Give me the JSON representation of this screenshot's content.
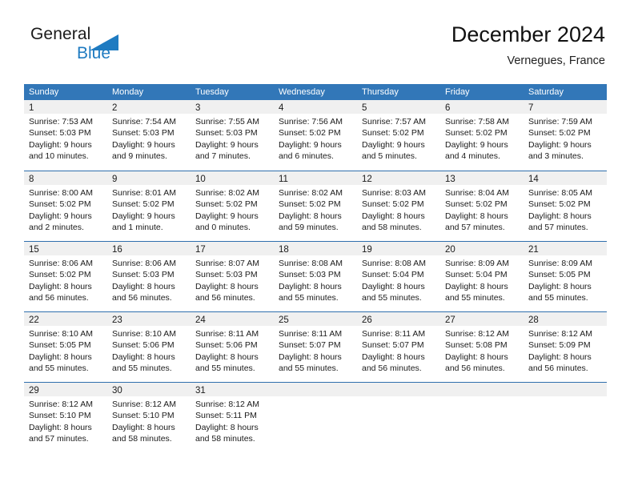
{
  "brand": {
    "line1": "General",
    "line2": "Blue",
    "mark_color": "#1f7bc1",
    "mark_icon": "triangle-logo-icon"
  },
  "header": {
    "title": "December 2024",
    "subtitle": "Vernegues, France"
  },
  "theme": {
    "header_blue": "#3277b8",
    "separator_blue": "#2f6fad",
    "day_band_gray": "#f0f0f0",
    "text_dark": "#1b1b1b"
  },
  "weekdays": [
    "Sunday",
    "Monday",
    "Tuesday",
    "Wednesday",
    "Thursday",
    "Friday",
    "Saturday"
  ],
  "weeks": [
    [
      {
        "day": "1",
        "sunrise": "Sunrise: 7:53 AM",
        "sunset": "Sunset: 5:03 PM",
        "daylight1": "Daylight: 9 hours",
        "daylight2": "and 10 minutes."
      },
      {
        "day": "2",
        "sunrise": "Sunrise: 7:54 AM",
        "sunset": "Sunset: 5:03 PM",
        "daylight1": "Daylight: 9 hours",
        "daylight2": "and 9 minutes."
      },
      {
        "day": "3",
        "sunrise": "Sunrise: 7:55 AM",
        "sunset": "Sunset: 5:03 PM",
        "daylight1": "Daylight: 9 hours",
        "daylight2": "and 7 minutes."
      },
      {
        "day": "4",
        "sunrise": "Sunrise: 7:56 AM",
        "sunset": "Sunset: 5:02 PM",
        "daylight1": "Daylight: 9 hours",
        "daylight2": "and 6 minutes."
      },
      {
        "day": "5",
        "sunrise": "Sunrise: 7:57 AM",
        "sunset": "Sunset: 5:02 PM",
        "daylight1": "Daylight: 9 hours",
        "daylight2": "and 5 minutes."
      },
      {
        "day": "6",
        "sunrise": "Sunrise: 7:58 AM",
        "sunset": "Sunset: 5:02 PM",
        "daylight1": "Daylight: 9 hours",
        "daylight2": "and 4 minutes."
      },
      {
        "day": "7",
        "sunrise": "Sunrise: 7:59 AM",
        "sunset": "Sunset: 5:02 PM",
        "daylight1": "Daylight: 9 hours",
        "daylight2": "and 3 minutes."
      }
    ],
    [
      {
        "day": "8",
        "sunrise": "Sunrise: 8:00 AM",
        "sunset": "Sunset: 5:02 PM",
        "daylight1": "Daylight: 9 hours",
        "daylight2": "and 2 minutes."
      },
      {
        "day": "9",
        "sunrise": "Sunrise: 8:01 AM",
        "sunset": "Sunset: 5:02 PM",
        "daylight1": "Daylight: 9 hours",
        "daylight2": "and 1 minute."
      },
      {
        "day": "10",
        "sunrise": "Sunrise: 8:02 AM",
        "sunset": "Sunset: 5:02 PM",
        "daylight1": "Daylight: 9 hours",
        "daylight2": "and 0 minutes."
      },
      {
        "day": "11",
        "sunrise": "Sunrise: 8:02 AM",
        "sunset": "Sunset: 5:02 PM",
        "daylight1": "Daylight: 8 hours",
        "daylight2": "and 59 minutes."
      },
      {
        "day": "12",
        "sunrise": "Sunrise: 8:03 AM",
        "sunset": "Sunset: 5:02 PM",
        "daylight1": "Daylight: 8 hours",
        "daylight2": "and 58 minutes."
      },
      {
        "day": "13",
        "sunrise": "Sunrise: 8:04 AM",
        "sunset": "Sunset: 5:02 PM",
        "daylight1": "Daylight: 8 hours",
        "daylight2": "and 57 minutes."
      },
      {
        "day": "14",
        "sunrise": "Sunrise: 8:05 AM",
        "sunset": "Sunset: 5:02 PM",
        "daylight1": "Daylight: 8 hours",
        "daylight2": "and 57 minutes."
      }
    ],
    [
      {
        "day": "15",
        "sunrise": "Sunrise: 8:06 AM",
        "sunset": "Sunset: 5:02 PM",
        "daylight1": "Daylight: 8 hours",
        "daylight2": "and 56 minutes."
      },
      {
        "day": "16",
        "sunrise": "Sunrise: 8:06 AM",
        "sunset": "Sunset: 5:03 PM",
        "daylight1": "Daylight: 8 hours",
        "daylight2": "and 56 minutes."
      },
      {
        "day": "17",
        "sunrise": "Sunrise: 8:07 AM",
        "sunset": "Sunset: 5:03 PM",
        "daylight1": "Daylight: 8 hours",
        "daylight2": "and 56 minutes."
      },
      {
        "day": "18",
        "sunrise": "Sunrise: 8:08 AM",
        "sunset": "Sunset: 5:03 PM",
        "daylight1": "Daylight: 8 hours",
        "daylight2": "and 55 minutes."
      },
      {
        "day": "19",
        "sunrise": "Sunrise: 8:08 AM",
        "sunset": "Sunset: 5:04 PM",
        "daylight1": "Daylight: 8 hours",
        "daylight2": "and 55 minutes."
      },
      {
        "day": "20",
        "sunrise": "Sunrise: 8:09 AM",
        "sunset": "Sunset: 5:04 PM",
        "daylight1": "Daylight: 8 hours",
        "daylight2": "and 55 minutes."
      },
      {
        "day": "21",
        "sunrise": "Sunrise: 8:09 AM",
        "sunset": "Sunset: 5:05 PM",
        "daylight1": "Daylight: 8 hours",
        "daylight2": "and 55 minutes."
      }
    ],
    [
      {
        "day": "22",
        "sunrise": "Sunrise: 8:10 AM",
        "sunset": "Sunset: 5:05 PM",
        "daylight1": "Daylight: 8 hours",
        "daylight2": "and 55 minutes."
      },
      {
        "day": "23",
        "sunrise": "Sunrise: 8:10 AM",
        "sunset": "Sunset: 5:06 PM",
        "daylight1": "Daylight: 8 hours",
        "daylight2": "and 55 minutes."
      },
      {
        "day": "24",
        "sunrise": "Sunrise: 8:11 AM",
        "sunset": "Sunset: 5:06 PM",
        "daylight1": "Daylight: 8 hours",
        "daylight2": "and 55 minutes."
      },
      {
        "day": "25",
        "sunrise": "Sunrise: 8:11 AM",
        "sunset": "Sunset: 5:07 PM",
        "daylight1": "Daylight: 8 hours",
        "daylight2": "and 55 minutes."
      },
      {
        "day": "26",
        "sunrise": "Sunrise: 8:11 AM",
        "sunset": "Sunset: 5:07 PM",
        "daylight1": "Daylight: 8 hours",
        "daylight2": "and 56 minutes."
      },
      {
        "day": "27",
        "sunrise": "Sunrise: 8:12 AM",
        "sunset": "Sunset: 5:08 PM",
        "daylight1": "Daylight: 8 hours",
        "daylight2": "and 56 minutes."
      },
      {
        "day": "28",
        "sunrise": "Sunrise: 8:12 AM",
        "sunset": "Sunset: 5:09 PM",
        "daylight1": "Daylight: 8 hours",
        "daylight2": "and 56 minutes."
      }
    ],
    [
      {
        "day": "29",
        "sunrise": "Sunrise: 8:12 AM",
        "sunset": "Sunset: 5:10 PM",
        "daylight1": "Daylight: 8 hours",
        "daylight2": "and 57 minutes."
      },
      {
        "day": "30",
        "sunrise": "Sunrise: 8:12 AM",
        "sunset": "Sunset: 5:10 PM",
        "daylight1": "Daylight: 8 hours",
        "daylight2": "and 58 minutes."
      },
      {
        "day": "31",
        "sunrise": "Sunrise: 8:12 AM",
        "sunset": "Sunset: 5:11 PM",
        "daylight1": "Daylight: 8 hours",
        "daylight2": "and 58 minutes."
      },
      {
        "day": "",
        "sunrise": "",
        "sunset": "",
        "daylight1": "",
        "daylight2": ""
      },
      {
        "day": "",
        "sunrise": "",
        "sunset": "",
        "daylight1": "",
        "daylight2": ""
      },
      {
        "day": "",
        "sunrise": "",
        "sunset": "",
        "daylight1": "",
        "daylight2": ""
      },
      {
        "day": "",
        "sunrise": "",
        "sunset": "",
        "daylight1": "",
        "daylight2": ""
      }
    ]
  ]
}
